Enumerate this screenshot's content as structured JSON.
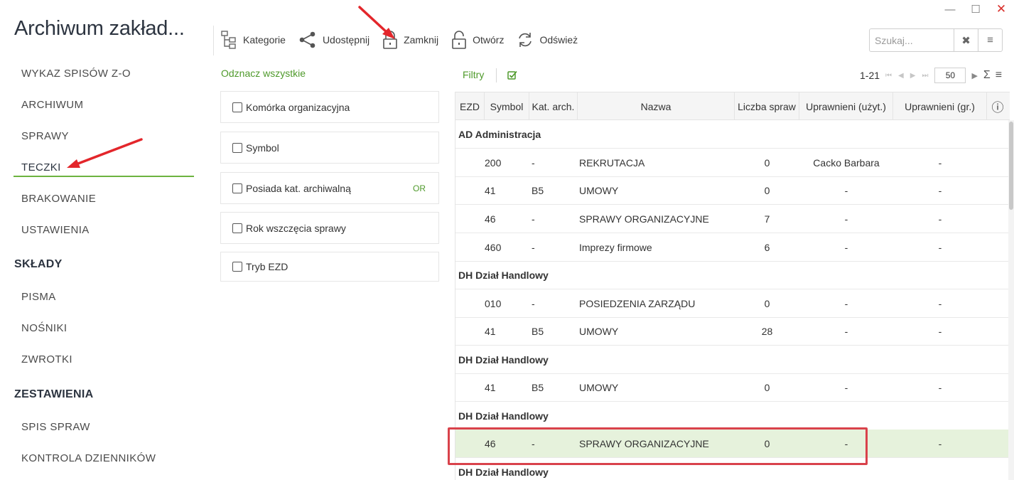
{
  "window": {
    "minimize_glyph": "—",
    "maximize_glyph": "☐",
    "close_glyph": "✕"
  },
  "app": {
    "title": "Archiwum zakład..."
  },
  "sidebar": {
    "items": [
      {
        "label": "WYKAZ SPISÓW Z-O"
      },
      {
        "label": "ARCHIWUM"
      },
      {
        "label": "SPRAWY"
      },
      {
        "label": "TECZKI",
        "active": true
      },
      {
        "label": "BRAKOWANIE"
      },
      {
        "label": "USTAWIENIA"
      }
    ],
    "sections": [
      {
        "title": "SKŁADY",
        "items": [
          {
            "label": "PISMA"
          },
          {
            "label": "NOŚNIKI"
          },
          {
            "label": "ZWROTKI"
          }
        ]
      },
      {
        "title": "ZESTAWIENIA",
        "items": [
          {
            "label": "SPIS SPRAW"
          },
          {
            "label": "KONTROLA DZIENNIKÓW"
          }
        ]
      }
    ]
  },
  "toolbar": {
    "buttons": [
      {
        "label": "Kategorie",
        "icon": "hierarchy-icon"
      },
      {
        "label": "Udostępnij",
        "icon": "share-icon"
      },
      {
        "label": "Zamknij",
        "icon": "lock-closed-icon"
      },
      {
        "label": "Otwórz",
        "icon": "lock-open-icon"
      },
      {
        "label": "Odśwież",
        "icon": "refresh-icon"
      }
    ],
    "search": {
      "placeholder": "Szukaj...",
      "clear_glyph": "✖",
      "menu_glyph": "≡"
    }
  },
  "filters": {
    "select_all": "Odznacz wszystkie",
    "items": [
      {
        "label": "Komórka organizacyjna",
        "checked": false
      },
      {
        "label": "Symbol",
        "checked": false
      },
      {
        "label": "Posiada kat. archiwalną",
        "checked": false,
        "badge": "OR"
      },
      {
        "label": "Rok wszczęcia sprawy",
        "checked": false
      },
      {
        "label": "Tryb EZD",
        "checked": false
      }
    ]
  },
  "grid": {
    "filters_label": "Filtry",
    "pager": {
      "range": "1-21",
      "page_size": "50",
      "first_glyph": "⏮",
      "prev_glyph": "◀",
      "next_glyph": "▶",
      "last_glyph": "⏭",
      "forward_glyph": "▶",
      "sum_glyph": "Σ",
      "menu_glyph": "≡"
    },
    "columns": [
      "EZD",
      "Symbol",
      "Kat. arch.",
      "Nazwa",
      "Liczba spraw",
      "Uprawnieni (użyt.)",
      "Uprawnieni (gr.)",
      "ⓘ"
    ],
    "rows": [
      {
        "type": "group",
        "label": "AD Administracja"
      },
      {
        "type": "data",
        "symbol": "200",
        "kat": "-",
        "nazwa": "REKRUTACJA",
        "liczba": "0",
        "uzyt": "Cacko Barbara",
        "gr": "-"
      },
      {
        "type": "data",
        "symbol": "41",
        "kat": "B5",
        "nazwa": "UMOWY",
        "liczba": "0",
        "uzyt": "-",
        "gr": "-"
      },
      {
        "type": "data",
        "symbol": "46",
        "kat": "-",
        "nazwa": "SPRAWY ORGANIZACYJNE",
        "liczba": "7",
        "uzyt": "-",
        "gr": "-"
      },
      {
        "type": "data",
        "symbol": "460",
        "kat": "-",
        "nazwa": "Imprezy firmowe",
        "liczba": "6",
        "uzyt": "-",
        "gr": "-"
      },
      {
        "type": "group",
        "label": "DH Dział Handlowy"
      },
      {
        "type": "data",
        "symbol": "010",
        "kat": "-",
        "nazwa": "POSIEDZENIA ZARZĄDU",
        "liczba": "0",
        "uzyt": "-",
        "gr": "-"
      },
      {
        "type": "data",
        "symbol": "41",
        "kat": "B5",
        "nazwa": "UMOWY",
        "liczba": "28",
        "uzyt": "-",
        "gr": "-"
      },
      {
        "type": "group",
        "label": "DH Dział Handlowy"
      },
      {
        "type": "data",
        "symbol": "41",
        "kat": "B5",
        "nazwa": "UMOWY",
        "liczba": "0",
        "uzyt": "-",
        "gr": "-"
      },
      {
        "type": "group",
        "label": "DH Dział Handlowy"
      },
      {
        "type": "data",
        "symbol": "46",
        "kat": "-",
        "nazwa": "SPRAWY ORGANIZACYJNE",
        "liczba": "0",
        "uzyt": "-",
        "gr": "-",
        "selected": true
      },
      {
        "type": "group",
        "label": "DH Dział Handlowy"
      }
    ]
  },
  "colors": {
    "accent_green": "#4f9a2b",
    "selected_row": "#e6f2dc",
    "annotation_red": "#d9424b"
  }
}
